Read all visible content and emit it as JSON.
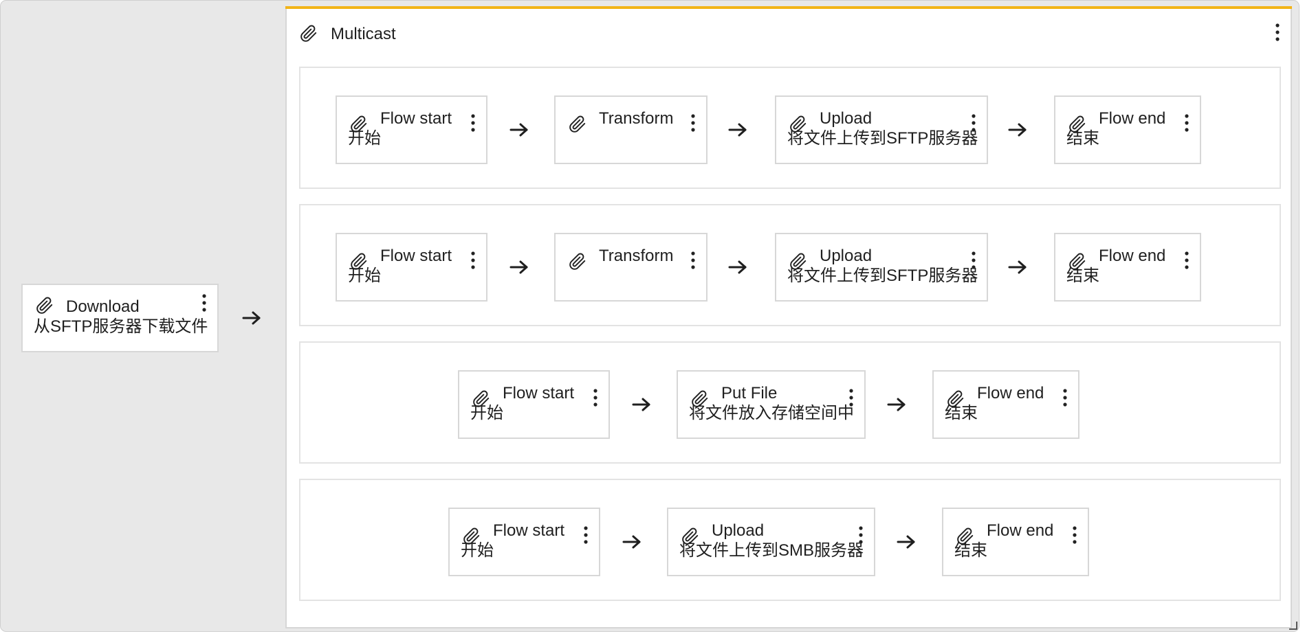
{
  "download": {
    "name": "Download",
    "desc": "从SFTP服务器下载文件"
  },
  "multicast": {
    "title": "Multicast",
    "accent_color": "#f2b418"
  },
  "branches": [
    {
      "nodes": [
        {
          "name": "Flow start",
          "desc": "开始"
        },
        {
          "name": "Transform",
          "desc": ""
        },
        {
          "name": "Upload",
          "desc": "将文件上传到SFTP服务器"
        },
        {
          "name": "Flow end",
          "desc": "结束"
        }
      ]
    },
    {
      "nodes": [
        {
          "name": "Flow start",
          "desc": "开始"
        },
        {
          "name": "Transform",
          "desc": ""
        },
        {
          "name": "Upload",
          "desc": "将文件上传到SFTP服务器"
        },
        {
          "name": "Flow end",
          "desc": "结束"
        }
      ]
    },
    {
      "nodes": [
        {
          "name": "Flow start",
          "desc": "开始"
        },
        {
          "name": "Put File",
          "desc": "将文件放入存储空间中"
        },
        {
          "name": "Flow end",
          "desc": "结束"
        }
      ]
    },
    {
      "nodes": [
        {
          "name": "Flow start",
          "desc": "开始"
        },
        {
          "name": "Upload",
          "desc": "将文件上传到SMB服务器"
        },
        {
          "name": "Flow end",
          "desc": "结束"
        }
      ]
    }
  ],
  "icons": {
    "step": "paperclip-icon",
    "menu": "kebab-menu-icon",
    "connector": "arrow-right-icon"
  }
}
